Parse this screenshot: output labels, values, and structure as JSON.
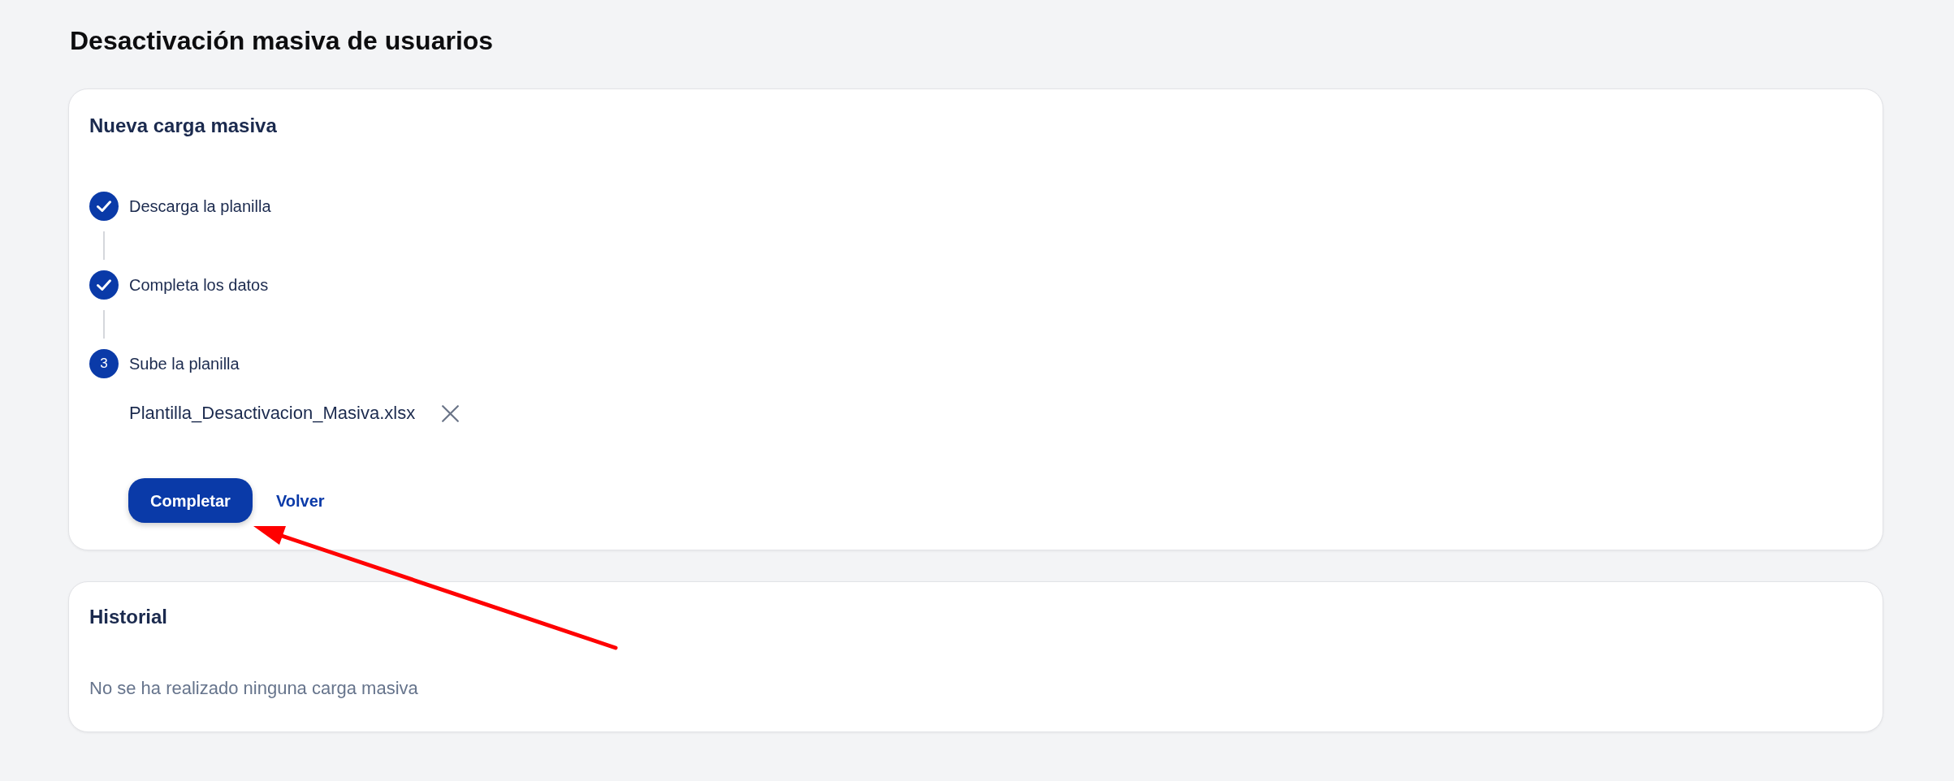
{
  "page": {
    "title": "Desactivación masiva de usuarios"
  },
  "upload_card": {
    "title": "Nueva carga masiva",
    "steps": [
      {
        "label": "Descarga la planilla",
        "completed": true
      },
      {
        "label": "Completa los datos",
        "completed": true
      },
      {
        "label": "Sube la planilla",
        "completed": false,
        "number": "3"
      }
    ],
    "file": {
      "name": "Plantilla_Desactivacion_Masiva.xlsx"
    },
    "actions": [
      {
        "label": "Completar",
        "kind": "primary"
      },
      {
        "label": "Volver",
        "kind": "link"
      }
    ]
  },
  "history_card": {
    "title": "Historial",
    "empty_message": "No se ha realizado ninguna carga masiva"
  },
  "annotations": [
    {
      "kind": "arrow"
    }
  ]
}
